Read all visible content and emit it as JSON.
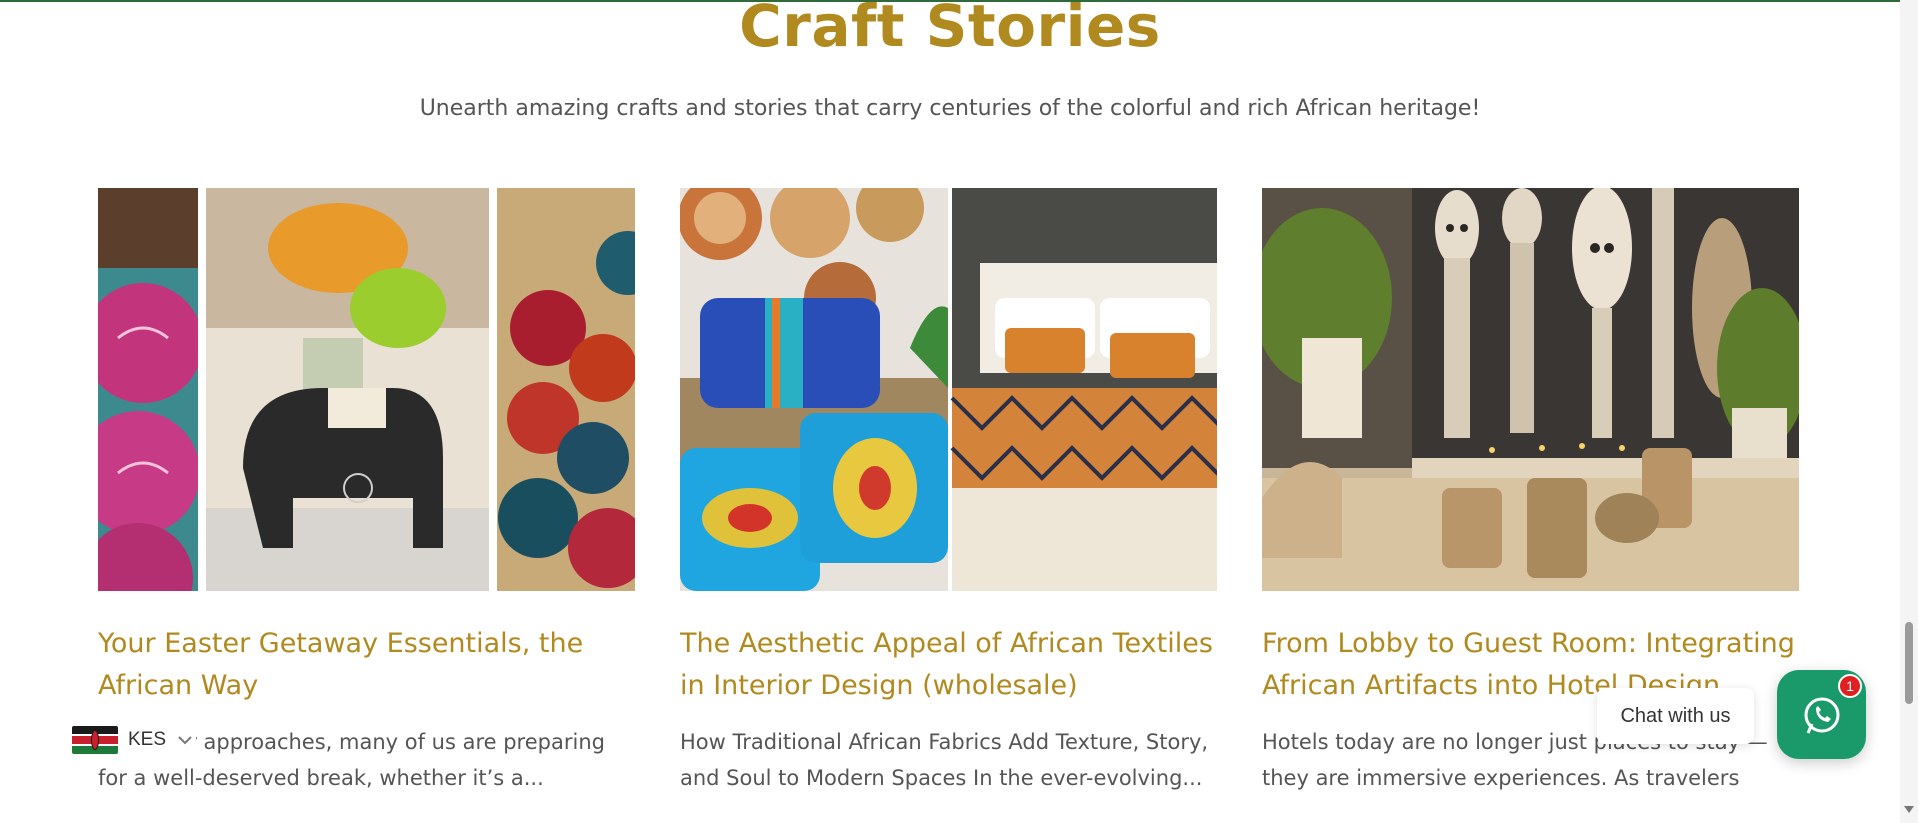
{
  "section": {
    "title": "Craft Stories",
    "subtitle": "Unearth amazing crafts and stories that carry centuries of the colorful and rich African heritage!"
  },
  "cards": [
    {
      "title": "Your Easter Getaway Essentials, the African Way",
      "excerpt": "As Easter approaches, many of us are preparing for a well-deserved break, whether it’s a..."
    },
    {
      "title": "The Aesthetic Appeal of African Textiles in Interior Design (wholesale)",
      "excerpt": "How Traditional African Fabrics Add Texture, Story, and Soul to Modern Spaces In the ever-evolving..."
    },
    {
      "title": "From Lobby to Guest Room: Integrating African Artifacts into Hotel Design",
      "excerpt": "Hotels today are no longer just places to stay — they are immersive experiences. As travelers seek..."
    }
  ],
  "currency": {
    "code": "KES",
    "flag_icon": "kenya-flag-icon"
  },
  "chat": {
    "label": "Chat with us",
    "badge_count": "1",
    "icon": "whatsapp-icon",
    "color": "#1a9a6a"
  },
  "colors": {
    "accent": "#b08a1e",
    "text": "#555555",
    "top_line": "#2f6b3a"
  }
}
